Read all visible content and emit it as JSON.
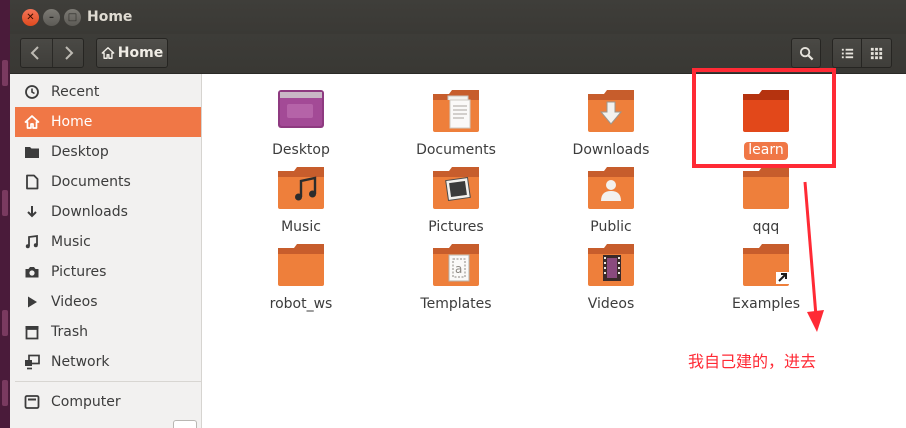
{
  "window": {
    "title": "Home"
  },
  "toolbar": {
    "location": "Home",
    "back_icon": "chevron-left-icon",
    "forward_icon": "chevron-right-icon",
    "search_icon": "search-icon",
    "list_view_icon": "list-view-icon",
    "grid_view_icon": "grid-view-icon"
  },
  "sidebar": {
    "items": [
      {
        "label": "Recent",
        "icon": "clock-icon",
        "active": false
      },
      {
        "label": "Home",
        "icon": "home-icon",
        "active": true
      },
      {
        "label": "Desktop",
        "icon": "folder-icon",
        "active": false
      },
      {
        "label": "Documents",
        "icon": "document-icon",
        "active": false
      },
      {
        "label": "Downloads",
        "icon": "download-icon",
        "active": false
      },
      {
        "label": "Music",
        "icon": "music-icon",
        "active": false
      },
      {
        "label": "Pictures",
        "icon": "camera-icon",
        "active": false
      },
      {
        "label": "Videos",
        "icon": "video-icon",
        "active": false
      },
      {
        "label": "Trash",
        "icon": "trash-icon",
        "active": false
      },
      {
        "label": "Network",
        "icon": "network-icon",
        "active": false
      },
      {
        "label": "Computer",
        "icon": "drive-icon",
        "active": false
      }
    ]
  },
  "files": [
    {
      "label": "Desktop",
      "icon": "desktop-folder-icon",
      "selected": false
    },
    {
      "label": "Documents",
      "icon": "documents-folder-icon",
      "selected": false
    },
    {
      "label": "Downloads",
      "icon": "downloads-folder-icon",
      "selected": false
    },
    {
      "label": "learn",
      "icon": "folder-icon",
      "selected": true
    },
    {
      "label": "Music",
      "icon": "music-folder-icon",
      "selected": false
    },
    {
      "label": "Pictures",
      "icon": "pictures-folder-icon",
      "selected": false
    },
    {
      "label": "Public",
      "icon": "public-folder-icon",
      "selected": false
    },
    {
      "label": "qqq",
      "icon": "folder-icon",
      "selected": false
    },
    {
      "label": "robot_ws",
      "icon": "folder-icon",
      "selected": false
    },
    {
      "label": "Templates",
      "icon": "templates-folder-icon",
      "selected": false
    },
    {
      "label": "Videos",
      "icon": "videos-folder-icon",
      "selected": false
    },
    {
      "label": "Examples",
      "icon": "link-folder-icon",
      "selected": false
    }
  ],
  "annotation": {
    "text": "我自己建的，进去",
    "color": "#ff2a35"
  },
  "colors": {
    "accent": "#f07746",
    "folder": "#ee7f3b",
    "titlebar": "#3c3b37"
  }
}
